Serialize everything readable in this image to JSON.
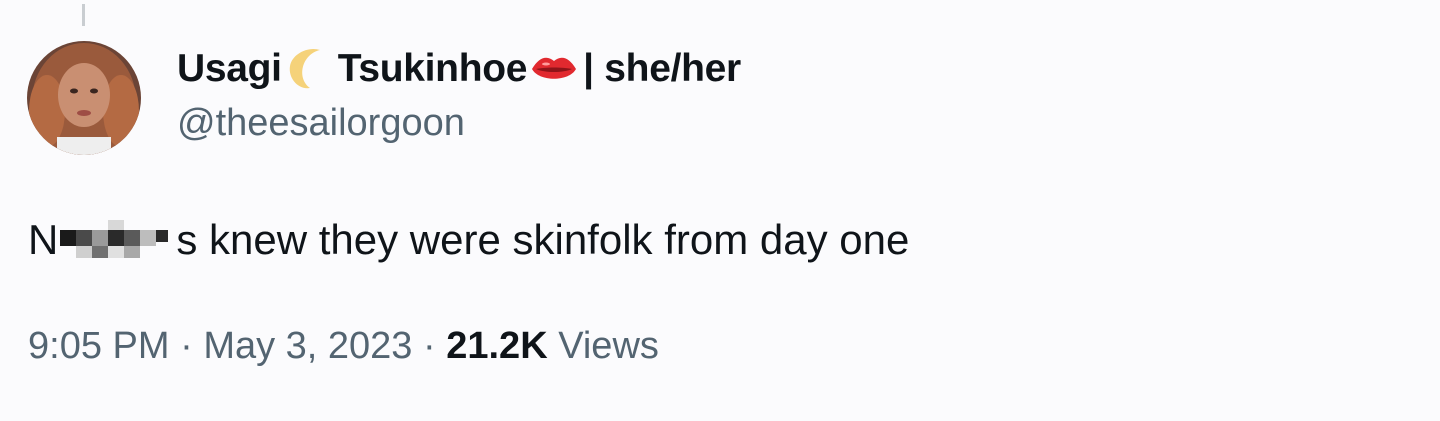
{
  "tweet": {
    "author": {
      "name_part1": "Usagi",
      "name_part2": "Tsukinhoe",
      "pronouns": "| she/her",
      "handle": "@theesailorgoon",
      "emoji_icons": [
        "crescent-moon-icon",
        "kiss-mark-icon"
      ]
    },
    "text": {
      "prefix": "N",
      "suffix": "s knew they were skinfolk from day one"
    },
    "meta": {
      "time": "9:05 PM",
      "separator": "·",
      "date": "May 3, 2023",
      "views_count": "21.2K",
      "views_label": "Views"
    }
  },
  "colors": {
    "background": "#fbfbfd",
    "primary_text": "#0f1419",
    "secondary_text": "#536471",
    "thread_line": "#c9cdd1"
  }
}
